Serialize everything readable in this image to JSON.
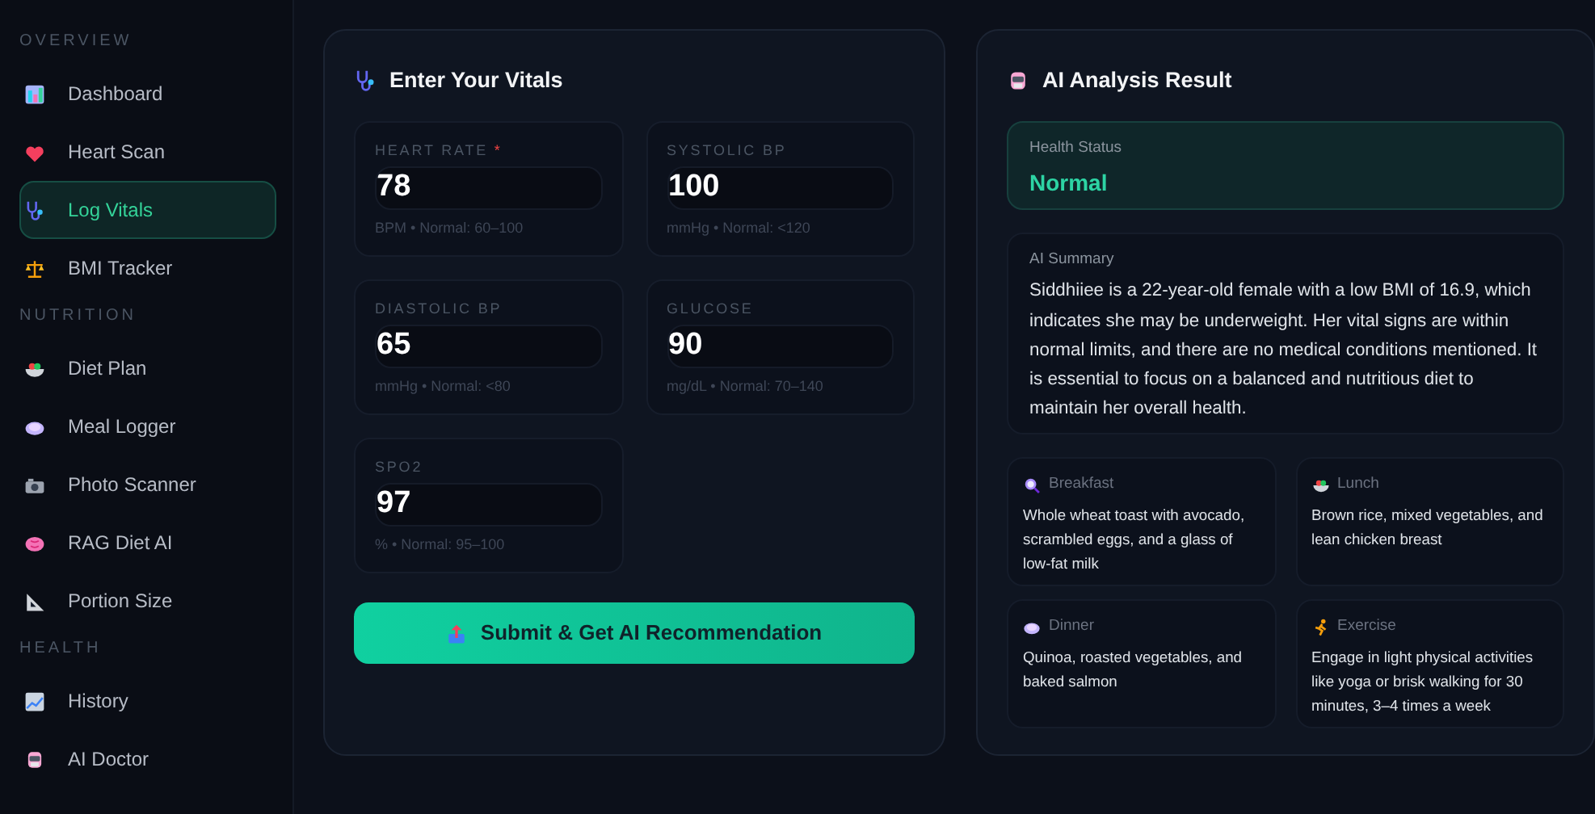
{
  "sidebar": {
    "sections": [
      {
        "title": "OVERVIEW",
        "items": [
          {
            "label": "Dashboard",
            "selected": false
          },
          {
            "label": "Heart Scan",
            "selected": false
          },
          {
            "label": "Log Vitals",
            "selected": true
          },
          {
            "label": "BMI Tracker",
            "selected": false
          }
        ]
      },
      {
        "title": "NUTRITION",
        "items": [
          {
            "label": "Diet Plan",
            "selected": false
          },
          {
            "label": "Meal Logger",
            "selected": false
          },
          {
            "label": "Photo Scanner",
            "selected": false
          },
          {
            "label": "RAG Diet AI",
            "selected": false
          },
          {
            "label": "Portion Size",
            "selected": false
          }
        ]
      },
      {
        "title": "HEALTH",
        "items": [
          {
            "label": "History",
            "selected": false
          },
          {
            "label": "AI Doctor",
            "selected": false
          }
        ]
      }
    ]
  },
  "vitals": {
    "title": "Enter Your Vitals",
    "fields": [
      {
        "label": "HEART RATE",
        "required_mark": "*",
        "value": "78",
        "hint": "BPM • Normal: 60–100"
      },
      {
        "label": "SYSTOLIC BP",
        "value": "100",
        "hint": "mmHg • Normal: <120"
      },
      {
        "label": "DIASTOLIC BP",
        "value": "65",
        "hint": "mmHg • Normal: <80"
      },
      {
        "label": "GLUCOSE",
        "value": "90",
        "hint": "mg/dL • Normal: 70–140"
      },
      {
        "label": "SPO2",
        "value": "97",
        "hint": "% • Normal: 95–100"
      }
    ],
    "submit": "Submit & Get AI Recommendation"
  },
  "result": {
    "title": "AI Analysis Result",
    "status": {
      "label": "Health Status",
      "value": "Normal"
    },
    "summary": {
      "label": "AI Summary",
      "text": "Siddhiiee is a 22-year-old female with a low BMI of 16.9, which indicates she may be underweight. Her vital signs are within normal limits, and there are no medical conditions mentioned. It is essential to focus on a balanced and nutritious diet to maintain her overall health."
    },
    "plan": [
      {
        "title": "Breakfast",
        "text": "Whole wheat toast with avocado, scrambled eggs, and a glass of low-fat milk"
      },
      {
        "title": "Lunch",
        "text": "Brown rice, mixed vegetables, and lean chicken breast"
      },
      {
        "title": "Dinner",
        "text": "Quinoa, roasted vegetables, and baked salmon"
      },
      {
        "title": "Exercise",
        "text": "Engage in light physical activities like yoga or brisk walking for 30 minutes, 3–4 times a week"
      }
    ]
  }
}
